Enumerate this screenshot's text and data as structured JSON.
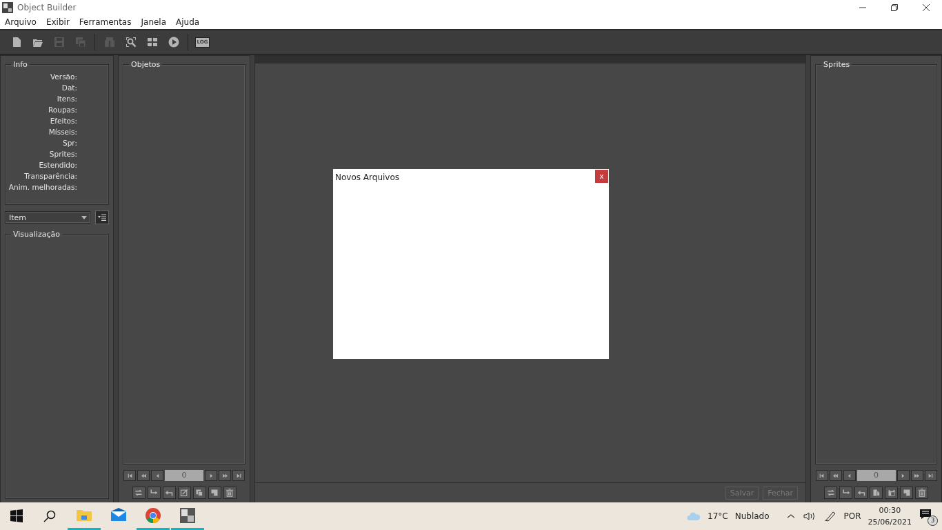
{
  "window": {
    "title": "Object Builder"
  },
  "menu": [
    "Arquivo",
    "Exibir",
    "Ferramentas",
    "Janela",
    "Ajuda"
  ],
  "toolbar": [
    {
      "kind": "new-file",
      "disabled": false
    },
    {
      "kind": "open-folder",
      "disabled": false
    },
    {
      "kind": "save",
      "disabled": true
    },
    {
      "kind": "save-all",
      "disabled": true
    },
    {
      "kind": "separator"
    },
    {
      "kind": "find",
      "disabled": true
    },
    {
      "kind": "search-sprite",
      "disabled": false
    },
    {
      "kind": "grid",
      "disabled": false
    },
    {
      "kind": "play",
      "disabled": false
    },
    {
      "kind": "separator"
    },
    {
      "kind": "log",
      "label": "LOG",
      "disabled": false
    }
  ],
  "info": {
    "title": "Info",
    "fields": [
      "Versão:",
      "Dat:",
      "Itens:",
      "Roupas:",
      "Efeitos:",
      "Mísseis:",
      "Spr:",
      "Sprites:",
      "Estendido:",
      "Transparência:",
      "Anim. melhoradas:"
    ]
  },
  "category": {
    "value": "Item"
  },
  "preview": {
    "title": "Visualização"
  },
  "objects": {
    "title": "Objetos",
    "page": "0",
    "actions": [
      {
        "kind": "replace"
      },
      {
        "kind": "export"
      },
      {
        "kind": "import"
      },
      {
        "kind": "edit"
      },
      {
        "kind": "duplicate"
      },
      {
        "kind": "new"
      },
      {
        "kind": "remove"
      }
    ]
  },
  "editor": {
    "buttons": [
      {
        "label": "Salvar",
        "disabled": true
      },
      {
        "label": "Fechar",
        "disabled": true
      }
    ]
  },
  "dialog": {
    "title": "Novos Arquivos",
    "close": "x"
  },
  "sprites": {
    "title": "Sprites",
    "page": "0",
    "actions": [
      {
        "kind": "replace"
      },
      {
        "kind": "export"
      },
      {
        "kind": "import"
      },
      {
        "kind": "copy"
      },
      {
        "kind": "paste"
      },
      {
        "kind": "new"
      },
      {
        "kind": "remove"
      }
    ]
  },
  "taskbar": {
    "apps": [
      {
        "kind": "explorer",
        "running": true
      },
      {
        "kind": "mail",
        "running": false
      },
      {
        "kind": "chrome",
        "running": true
      },
      {
        "kind": "object-builder",
        "running": true
      }
    ],
    "temperature": "17°C",
    "weather": "Nublado",
    "language": "POR",
    "time": "00:30",
    "date": "25/06/2021",
    "notifications": "3"
  }
}
